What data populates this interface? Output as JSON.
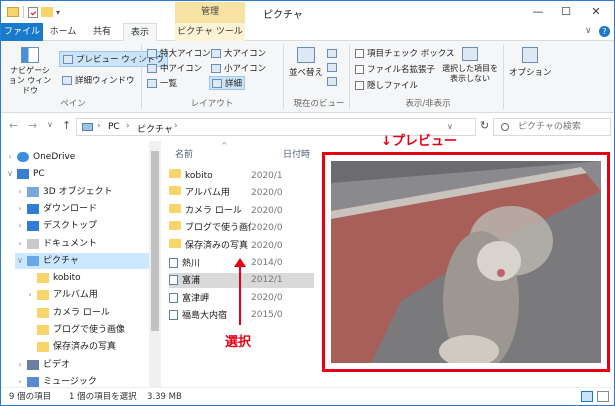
{
  "titlebar": {
    "title": "ピクチャ",
    "context_tab": "管理",
    "min": "—",
    "max": "☐",
    "close": "✕"
  },
  "tabs": {
    "file": "ファイル",
    "home": "ホーム",
    "share": "共有",
    "view": "表示",
    "pictures": "ピクチャ ツール"
  },
  "ribbon": {
    "nav_pane": "ナビゲーション ウィンドウ",
    "preview_pane": "プレビュー ウィンドウ",
    "details_pane": "詳細ウィンドウ",
    "pane_group": "ペイン",
    "layout": {
      "xl_icons": "特大アイコン",
      "l_icons": "大アイコン",
      "m_icons": "中アイコン",
      "s_icons": "小アイコン",
      "list": "一覧",
      "details": "詳細",
      "group": "レイアウト"
    },
    "sort": "並べ替え",
    "current_view_group": "現在のビュー",
    "item_checkbox": "項目チェック ボックス",
    "file_ext": "ファイル名拡張子",
    "hidden": "隠しファイル",
    "hide_selected": "選択した項目を 表示しない",
    "options": "オプション",
    "show_hide_group": "表示/非表示"
  },
  "address": {
    "back": "←",
    "forward": "→",
    "recent": "∨",
    "up": "↑",
    "path1": "PC",
    "sep": "›",
    "path2": "ピクチャ",
    "dropdown": "∨",
    "refresh": "↻",
    "search_placeholder": "ピクチャの検索"
  },
  "nav": [
    {
      "label": "OneDrive",
      "exp": "›"
    },
    {
      "label": "PC",
      "exp": "∨"
    },
    {
      "label": "3D オブジェクト",
      "exp": "›"
    },
    {
      "label": "ダウンロード",
      "exp": "›"
    },
    {
      "label": "デスクトップ",
      "exp": "›"
    },
    {
      "label": "ドキュメント",
      "exp": "›"
    },
    {
      "label": "ピクチャ",
      "exp": "∨"
    },
    {
      "label": "kobito",
      "exp": ""
    },
    {
      "label": "アルバム用",
      "exp": "›"
    },
    {
      "label": "カメラ ロール",
      "exp": ""
    },
    {
      "label": "ブログで使う画像",
      "exp": ""
    },
    {
      "label": "保存済みの写真",
      "exp": ""
    },
    {
      "label": "ビデオ",
      "exp": "›"
    },
    {
      "label": "ミュージック",
      "exp": "›"
    }
  ],
  "files": {
    "col_name": "名前",
    "col_date": "日付時",
    "sort_arrow": "^",
    "rows": [
      {
        "name": "kobito",
        "date": "2020/1",
        "type": "folder"
      },
      {
        "name": "アルバム用",
        "date": "2020/0",
        "type": "folder"
      },
      {
        "name": "カメラ ロール",
        "date": "2020/0",
        "type": "folder"
      },
      {
        "name": "ブログで使う画像",
        "date": "2020/0",
        "type": "folder"
      },
      {
        "name": "保存済みの写真",
        "date": "2020/0",
        "type": "folder"
      },
      {
        "name": "熱川",
        "date": "2014/0",
        "type": "image"
      },
      {
        "name": "富浦",
        "date": "2012/1",
        "type": "image"
      },
      {
        "name": "富津岬",
        "date": "2020/0",
        "type": "image"
      },
      {
        "name": "福島大内宿",
        "date": "2015/0",
        "type": "image"
      }
    ]
  },
  "annotations": {
    "preview": "↓プレビュー",
    "select": "選択",
    "accent": "#e60012"
  },
  "status": {
    "count": "9 個の項目",
    "selected": "1 個の項目を選択",
    "size": "3.39 MB"
  }
}
